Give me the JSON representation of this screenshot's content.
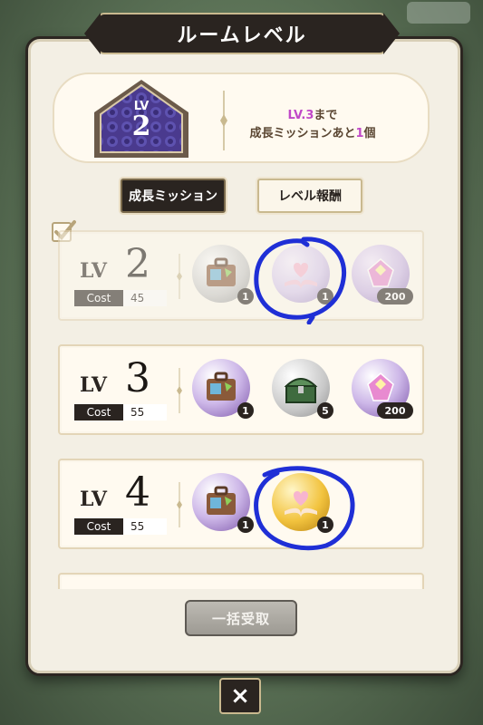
{
  "title": "ルームレベル",
  "current_level": {
    "lv_label": "LV",
    "value": "2"
  },
  "next_info": {
    "line1_highlight": "LV.3",
    "line1_rest": "まで",
    "line2_prefix": "成長ミッションあと",
    "line2_count": "1",
    "line2_suffix": "個"
  },
  "tabs": [
    {
      "label": "成長ミッション",
      "active": true
    },
    {
      "label": "レベル報酬",
      "active": false
    }
  ],
  "rows": [
    {
      "lv_label": "LV",
      "level": "2",
      "cost_label": "Cost",
      "cost": "45",
      "completed": true,
      "rewards": [
        {
          "icon": "suitcase-icon",
          "count": "1"
        },
        {
          "icon": "book-hearts-icon",
          "count": "1"
        },
        {
          "icon": "gem-icon",
          "count": "200"
        }
      ]
    },
    {
      "lv_label": "LV",
      "level": "3",
      "cost_label": "Cost",
      "cost": "55",
      "completed": false,
      "rewards": [
        {
          "icon": "suitcase-icon",
          "count": "1"
        },
        {
          "icon": "treasure-chest-icon",
          "count": "5"
        },
        {
          "icon": "gem-icon",
          "count": "200"
        }
      ]
    },
    {
      "lv_label": "LV",
      "level": "4",
      "cost_label": "Cost",
      "cost": "55",
      "completed": false,
      "rewards": [
        {
          "icon": "suitcase-icon",
          "count": "1"
        },
        {
          "icon": "book-hearts-icon",
          "count": "1"
        }
      ]
    }
  ],
  "claim_all_label": "一括受取",
  "close_label": "×",
  "colors": {
    "panel": "#f3efe4",
    "dark": "#2a2420",
    "highlight": "#c048c8",
    "annotation": "#1f2fd6"
  }
}
